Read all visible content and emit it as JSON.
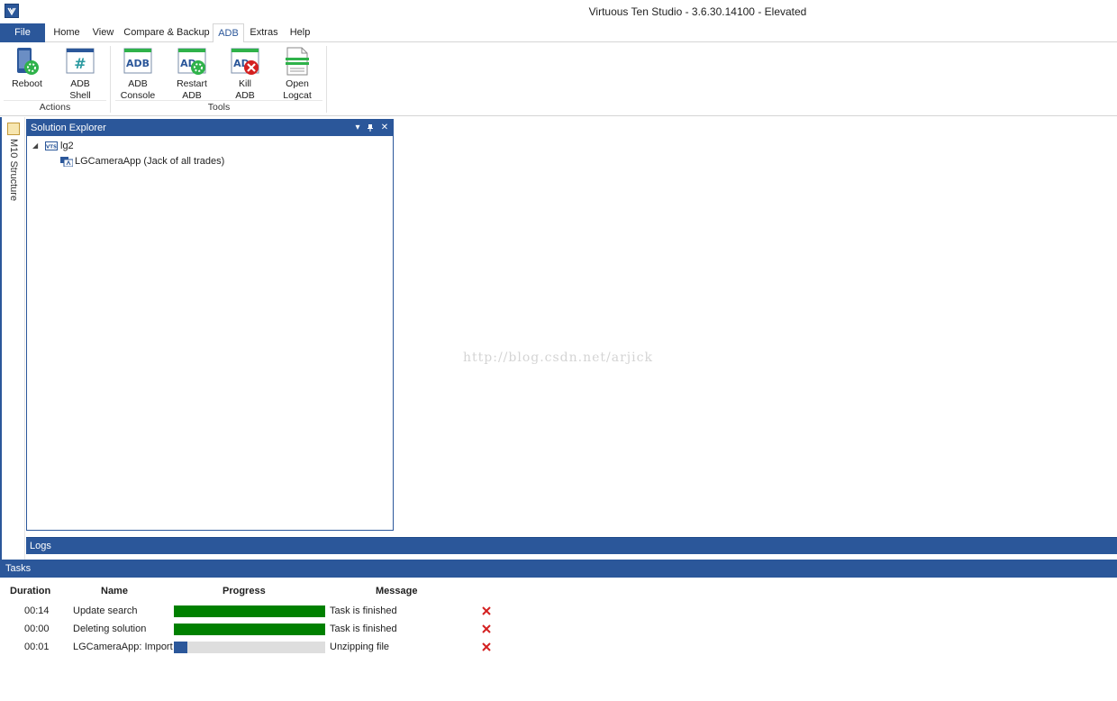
{
  "window": {
    "title": "Virtuous Ten Studio - 3.6.30.14100 - Elevated"
  },
  "menu": {
    "tabs": [
      {
        "label": "File"
      },
      {
        "label": "Home"
      },
      {
        "label": "View"
      },
      {
        "label": "Compare & Backup"
      },
      {
        "label": "ADB"
      },
      {
        "label": "Extras"
      },
      {
        "label": "Help"
      }
    ],
    "selected": "ADB"
  },
  "ribbon": {
    "groups": [
      {
        "label": "Actions",
        "buttons": [
          {
            "line1": "Reboot",
            "line2": "",
            "icon": "reboot-icon"
          },
          {
            "line1": "ADB",
            "line2": "Shell",
            "icon": "adb-shell-icon"
          }
        ]
      },
      {
        "label": "Tools",
        "buttons": [
          {
            "line1": "ADB",
            "line2": "Console",
            "icon": "adb-console-icon"
          },
          {
            "line1": "Restart",
            "line2": "ADB",
            "icon": "restart-adb-icon"
          },
          {
            "line1": "Kill",
            "line2": "ADB",
            "icon": "kill-adb-icon"
          },
          {
            "line1": "Open",
            "line2": "Logcat",
            "icon": "open-logcat-icon"
          }
        ]
      }
    ],
    "icon_text": {
      "adb": "ADB",
      "ad": "AD",
      "hash": "#"
    }
  },
  "side_strip": {
    "label": "M10 Structure"
  },
  "solution_explorer": {
    "title": "Solution Explorer",
    "tree": [
      {
        "label": "lg2",
        "badge": "VTS",
        "expanded": true,
        "level": 0
      },
      {
        "label": "LGCameraApp (Jack of all trades)",
        "level": 1
      }
    ]
  },
  "watermark": "http://blog.csdn.net/arjick",
  "logs": {
    "title": "Logs"
  },
  "tasks": {
    "title": "Tasks",
    "columns": [
      "Duration",
      "Name",
      "Progress",
      "Message"
    ],
    "rows": [
      {
        "duration": "00:14",
        "name": "Update search",
        "progress": 1.0,
        "message": "Task is finished",
        "status": "finished"
      },
      {
        "duration": "00:00",
        "name": "Deleting solution",
        "progress": 1.0,
        "message": "Task is finished",
        "status": "finished"
      },
      {
        "duration": "00:01",
        "name": "LGCameraApp: Import",
        "progress": 0.09,
        "message": "Unzipping file",
        "status": "running"
      }
    ]
  },
  "colors": {
    "accent": "#2b579a",
    "progress_done": "#008000",
    "progress_running": "#2b579a",
    "cancel": "#d42020"
  }
}
